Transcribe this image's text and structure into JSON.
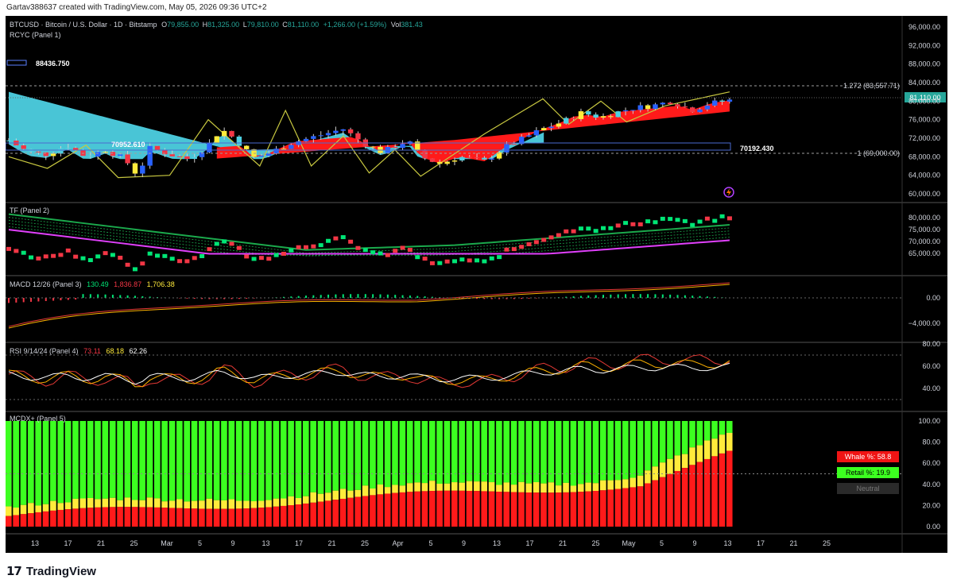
{
  "header": {
    "created_by": "Gartav388637 created with TradingView.com, May 05, 2026 09:36 UTC+2"
  },
  "legend": {
    "symbol": "BTCUSD · Bitcoin / U.S. Dollar · 1D · Bitstamp",
    "o_label": "O",
    "o": "79,855.00",
    "h_label": "H",
    "h": "81,325.00",
    "l_label": "L",
    "l": "79,810.00",
    "c_label": "C",
    "c": "81,110.00",
    "change": "+1,266.00 (+1.59%)",
    "vol_label": "Vol",
    "vol": "381.43"
  },
  "panels": {
    "p1": {
      "title": "RCYC (Panel 1)"
    },
    "p2": {
      "title": "TF  (Panel 2)"
    },
    "p3": {
      "title": "MACD 12/26 (Panel 3)",
      "v1": "130.49",
      "v2": "1,836.87",
      "v3": "1,706.38"
    },
    "p4": {
      "title": "RSI 9/14/24 (Panel 4)",
      "v1": "73.11",
      "v2": "68.18",
      "v3": "62.26"
    },
    "p5": {
      "title": "MCDX+ (Panel 5)"
    }
  },
  "annotations": {
    "box_label": "88436.750",
    "left_level": "70952.610",
    "right_level": "70192.430",
    "fib_1272": "1.272 (83,557.71)",
    "fib_1": "1 (69,000.00)",
    "last_price": "81,110.00"
  },
  "axes": {
    "p1": [
      "96,000.00",
      "92,000.00",
      "88,000.00",
      "84,000.00",
      "80,000.00",
      "76,000.00",
      "72,000.00",
      "68,000.00",
      "64,000.00",
      "60,000.00"
    ],
    "p2": [
      "80,000.00",
      "75,000.00",
      "70,000.00",
      "65,000.00"
    ],
    "p3": [
      "0.00",
      "−4,000.00"
    ],
    "p4": [
      "80.00",
      "60.00",
      "40.00"
    ],
    "p5": [
      "100.00",
      "80.00",
      "60.00",
      "40.00",
      "20.00",
      "0.00"
    ]
  },
  "mcdx_labels": {
    "whale": "Whale %: 58.8",
    "retail": "Retail %: 19.9",
    "neutral": "Neutral"
  },
  "xaxis": [
    "13",
    "17",
    "21",
    "25",
    "Mar",
    "5",
    "9",
    "13",
    "17",
    "21",
    "25",
    "Apr",
    "5",
    "9",
    "13",
    "17",
    "21",
    "25",
    "May",
    "5",
    "9",
    "13",
    "17",
    "21",
    "25"
  ],
  "colors": {
    "bg": "#000000",
    "up": "#2962ff",
    "down": "#f23645",
    "cloud": "#4dd0e1",
    "red_band": "#ff1a1a",
    "green": "#00e676",
    "magenta": "#e040fb",
    "yellow": "#ffeb3b",
    "lime": "#3cff20",
    "price_tag": "#26a69a"
  },
  "footer": {
    "brand": "TradingView"
  }
}
